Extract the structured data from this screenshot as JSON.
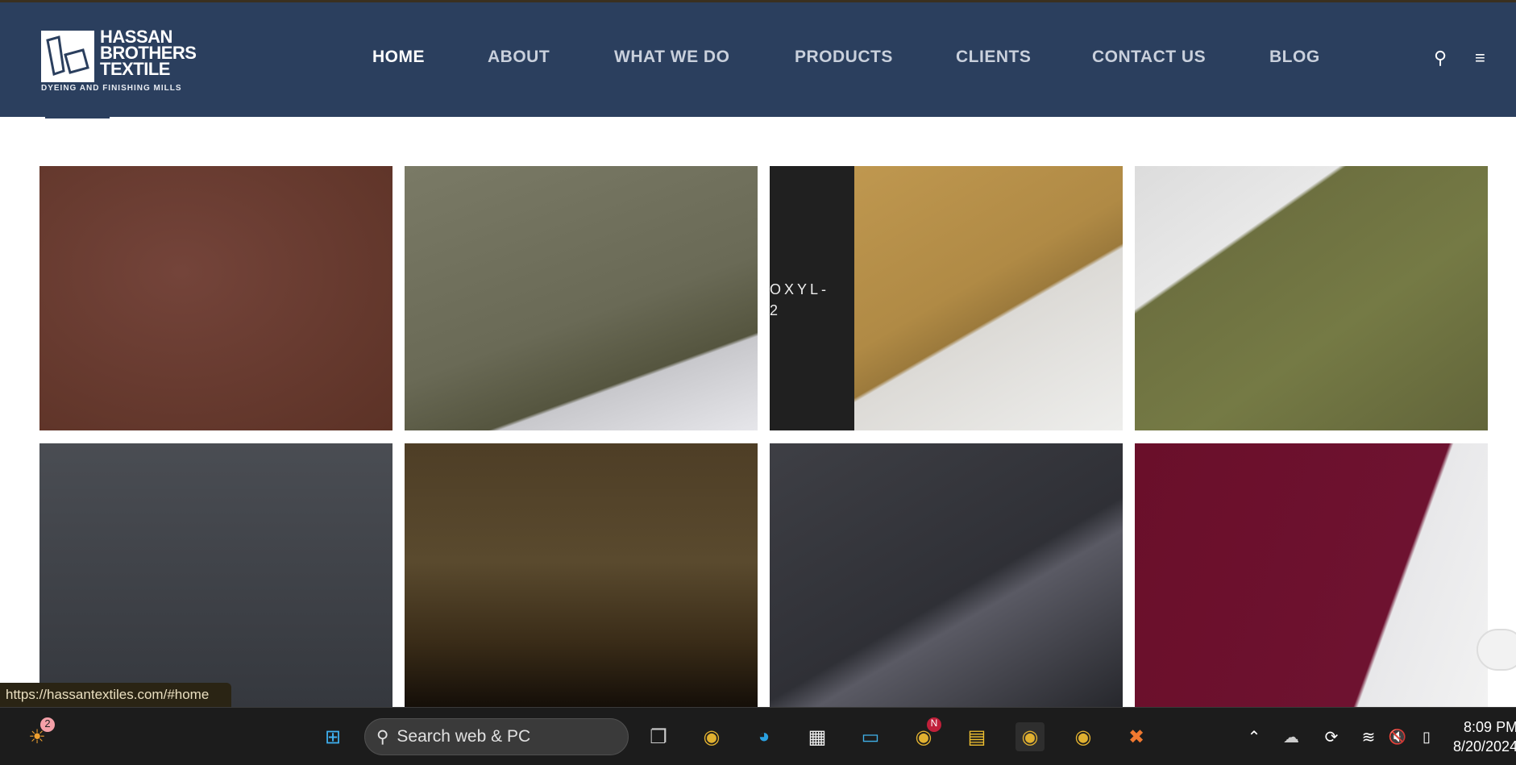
{
  "header": {
    "logo": {
      "line1": "HASSAN",
      "line2": "BROTHERS",
      "line3": "TEXTILE",
      "tagline": "DYEING AND FINISHING MILLS"
    },
    "nav": [
      {
        "label": "HOME",
        "active": true
      },
      {
        "label": "ABOUT"
      },
      {
        "label": "WHAT WE DO"
      },
      {
        "label": "PRODUCTS"
      },
      {
        "label": "CLIENTS"
      },
      {
        "label": "CONTACT US"
      },
      {
        "label": "BLOG"
      }
    ],
    "icons": [
      "search-icon",
      "menu-icon"
    ]
  },
  "gallery": {
    "tiles": [
      {
        "color": "#6a3c2e"
      },
      {
        "color": "#6b6a58"
      },
      {
        "color": "#b08a45",
        "overlay_text_line1": "OXYL-",
        "overlay_text_line2": "2"
      },
      {
        "color": "#6d7040"
      },
      {
        "color": "#3c3f45"
      },
      {
        "color": "#4a3a22"
      },
      {
        "color": "#2f3036"
      },
      {
        "color": "#6a0f2a"
      }
    ]
  },
  "status_url": "https://hassantextiles.com/#home",
  "taskbar": {
    "widget_badge": "2",
    "search_placeholder": "Search web & PC",
    "chrome_badge": "N",
    "time": "8:09 PM",
    "date": "8/20/2024"
  }
}
